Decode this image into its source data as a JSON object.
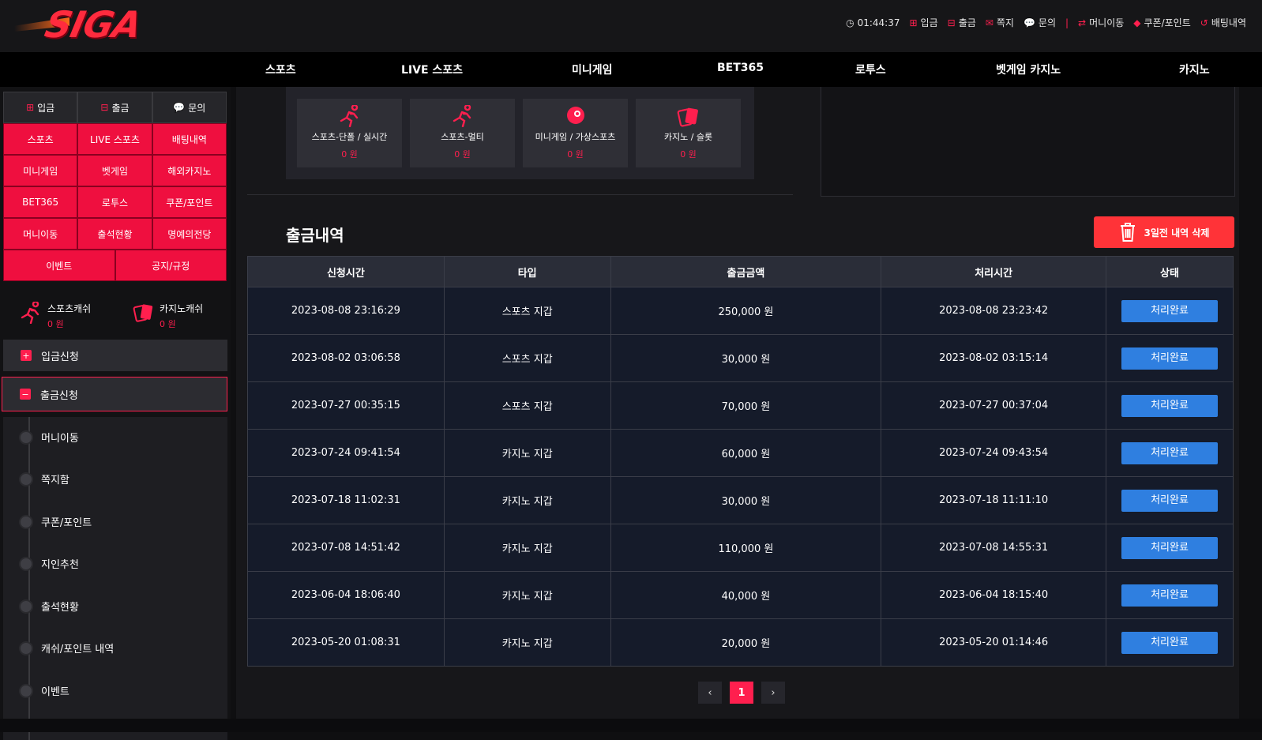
{
  "brand": {
    "logo_text": "SIGA",
    "accent": "#ff1f4e"
  },
  "util_bar": {
    "clock": "01:44:37",
    "links": [
      "입금",
      "출금",
      "쪽지",
      "문의",
      "머니이동",
      "쿠폰/포인트",
      "배팅내역"
    ]
  },
  "main_nav": [
    "스포츠",
    "LIVE 스포츠",
    "미니게임",
    "BET365",
    "로투스",
    "벳게임 카지노",
    "카지노"
  ],
  "sidebar": {
    "top": [
      "입금",
      "출금",
      "문의"
    ],
    "grid": [
      [
        "스포츠",
        "LIVE 스포츠",
        "배팅내역"
      ],
      [
        "미니게임",
        "벳게임",
        "해외카지노"
      ],
      [
        "BET365",
        "로투스",
        "쿠폰/포인트"
      ],
      [
        "머니이동",
        "출석현황",
        "명예의전당"
      ],
      [
        "이벤트",
        "공지/규정"
      ]
    ],
    "sports_cash_label": "스포츠캐쉬",
    "sports_cash_value": "0 원",
    "casino_cash_label": "카지노캐쉬",
    "casino_cash_value": "0 원",
    "deposit_request": "입금신청",
    "withdraw_request": "출금신청",
    "submenu": [
      "머니이동",
      "쪽지함",
      "쿠폰/포인트",
      "지인추천",
      "출석현황",
      "캐쉬/포인트 내역",
      "이벤트"
    ]
  },
  "game_cards": [
    {
      "label": "스포츠-단폴 / 실시간",
      "value": "0 원",
      "icon": "runner-icon"
    },
    {
      "label": "스포츠-멀티",
      "value": "0 원",
      "icon": "runner-icon"
    },
    {
      "label": "미니게임 / 가상스포츠",
      "value": "0 원",
      "icon": "ball-icon"
    },
    {
      "label": "카지노 / 슬롯",
      "value": "0 원",
      "icon": "cards-icon"
    }
  ],
  "history": {
    "title": "출금내역",
    "delete_button": "3일전 내역 삭제",
    "columns": [
      "신청시간",
      "타입",
      "출금금액",
      "처리시간",
      "상태"
    ],
    "rows": [
      [
        "2023-08-08 23:16:29",
        "스포츠 지갑",
        "250,000 원",
        "2023-08-08 23:23:42",
        "처리완료"
      ],
      [
        "2023-08-02 03:06:58",
        "스포츠 지갑",
        "30,000 원",
        "2023-08-02 03:15:14",
        "처리완료"
      ],
      [
        "2023-07-27 00:35:15",
        "스포츠 지갑",
        "70,000 원",
        "2023-07-27 00:37:04",
        "처리완료"
      ],
      [
        "2023-07-24 09:41:54",
        "카지노 지갑",
        "60,000 원",
        "2023-07-24 09:43:54",
        "처리완료"
      ],
      [
        "2023-07-18 11:02:31",
        "카지노 지갑",
        "30,000 원",
        "2023-07-18 11:11:10",
        "처리완료"
      ],
      [
        "2023-07-08 14:51:42",
        "카지노 지갑",
        "110,000 원",
        "2023-07-08 14:55:31",
        "처리완료"
      ],
      [
        "2023-06-04 18:06:40",
        "카지노 지갑",
        "40,000 원",
        "2023-06-04 18:15:40",
        "처리완료"
      ],
      [
        "2023-05-20 01:08:31",
        "카지노 지갑",
        "20,000 원",
        "2023-05-20 01:14:46",
        "처리완료"
      ]
    ]
  },
  "pagination": {
    "prev": "‹",
    "current": "1",
    "next": "›"
  }
}
